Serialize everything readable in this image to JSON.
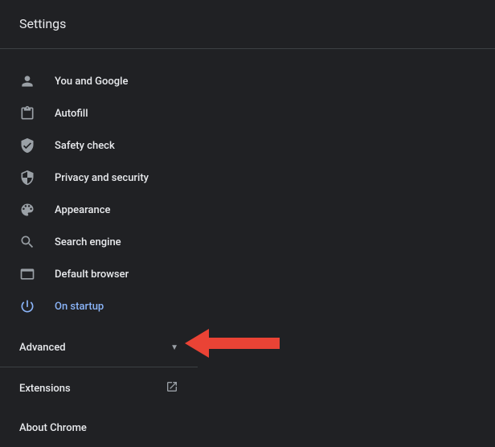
{
  "header": {
    "title": "Settings"
  },
  "sidebar": {
    "items": [
      {
        "label": "You and Google"
      },
      {
        "label": "Autofill"
      },
      {
        "label": "Safety check"
      },
      {
        "label": "Privacy and security"
      },
      {
        "label": "Appearance"
      },
      {
        "label": "Search engine"
      },
      {
        "label": "Default browser"
      },
      {
        "label": "On startup"
      }
    ],
    "advanced_label": "Advanced",
    "extensions_label": "Extensions",
    "about_label": "About Chrome"
  }
}
